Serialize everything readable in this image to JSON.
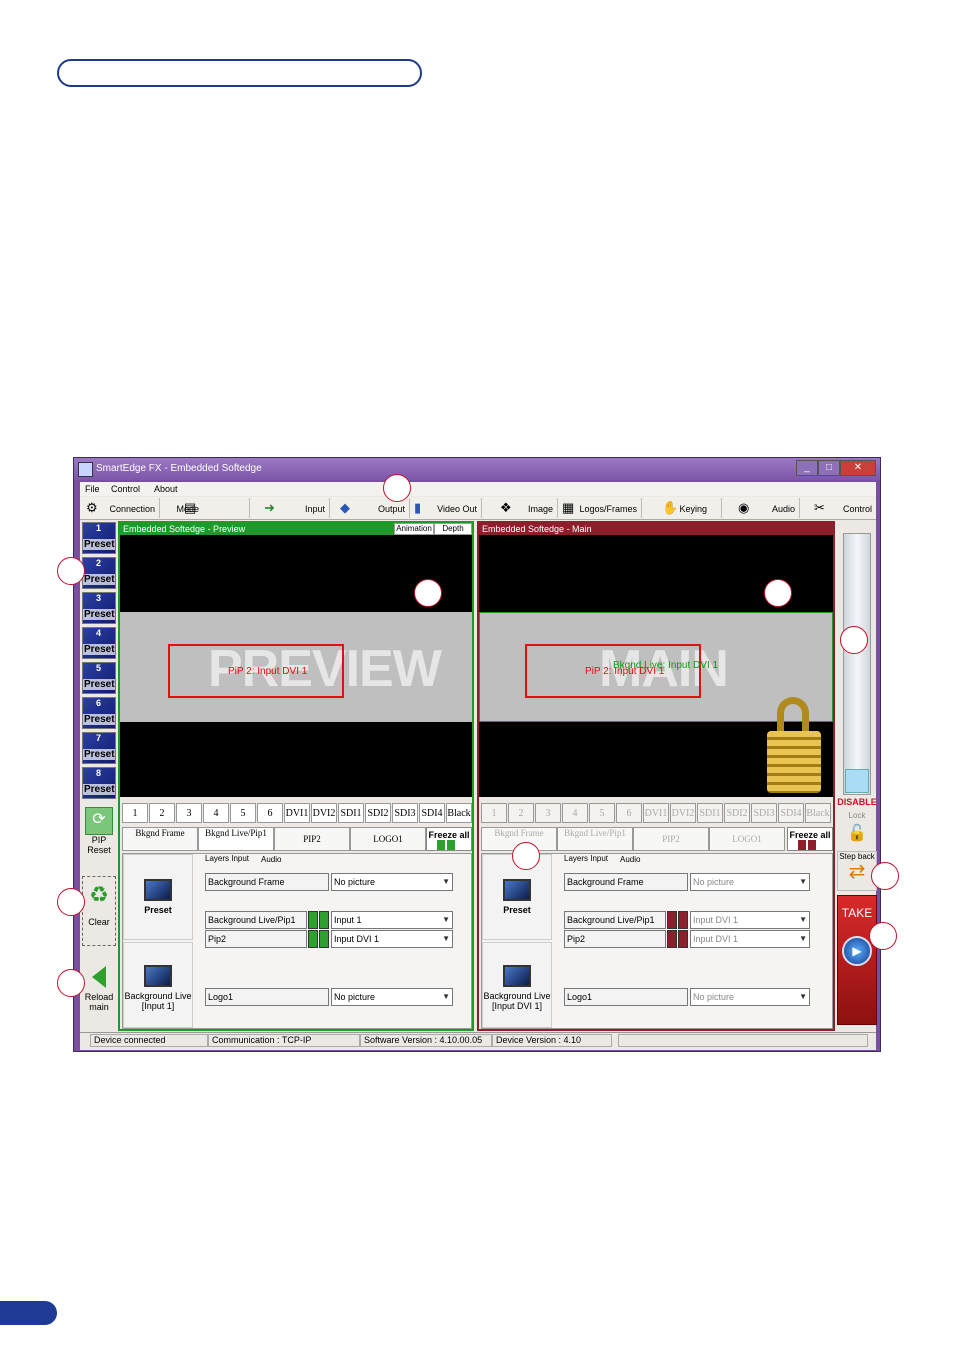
{
  "window": {
    "title": "SmartEdge FX - Embedded Softedge",
    "buttons": {
      "minimize": "_",
      "maximize": "□",
      "close": "✕"
    }
  },
  "menu": [
    "File",
    "Control",
    "About"
  ],
  "toolbar": [
    {
      "label": "Connection",
      "icon": "connection-icon"
    },
    {
      "label": "Mode",
      "icon": "mode-icon"
    },
    {
      "label": "Input",
      "icon": "input-icon"
    },
    {
      "label": "Output",
      "icon": "output-icon"
    },
    {
      "label": "Video Out",
      "icon": "video-out-icon"
    },
    {
      "label": "Image",
      "icon": "image-icon"
    },
    {
      "label": "Logos/Frames",
      "icon": "logos-icon"
    },
    {
      "label": "Keying",
      "icon": "keying-icon"
    },
    {
      "label": "Audio",
      "icon": "audio-icon"
    },
    {
      "label": "Control",
      "icon": "control-icon"
    }
  ],
  "presets": {
    "items": [
      {
        "num": "1",
        "label": "Preset"
      },
      {
        "num": "2",
        "label": "Preset"
      },
      {
        "num": "3",
        "label": "Preset"
      },
      {
        "num": "4",
        "label": "Preset"
      },
      {
        "num": "5",
        "label": "Preset"
      },
      {
        "num": "6",
        "label": "Preset"
      },
      {
        "num": "7",
        "label": "Preset"
      },
      {
        "num": "8",
        "label": "Preset"
      }
    ],
    "pip_reset": "PIP Reset",
    "clear": "Clear",
    "reload_main": "Reload main"
  },
  "preview": {
    "header": "Embedded Softedge - Preview",
    "tabs": [
      "Animation",
      "Depth"
    ],
    "watermark": "PREVIEW",
    "pip_label": "PiP 2: Input DVI 1",
    "sources": [
      "1",
      "2",
      "3",
      "4",
      "5",
      "6",
      "DVI1",
      "DVI2",
      "SDI1",
      "SDI2",
      "SDI3",
      "SDI4",
      "Black"
    ],
    "layer_tabs": [
      "Bkgnd Frame",
      "Bkgnd Live/Pip1",
      "PIP2",
      "LOGO1"
    ],
    "freeze": "Freeze all",
    "subtabs": [
      "Layers Input",
      "Audio"
    ],
    "preset_btn": "Preset",
    "bg_live_btn": "Background Live [Input 1]",
    "rows": [
      {
        "layer": "Background Frame",
        "value": "No picture"
      },
      {
        "layer": "Background Live/Pip1",
        "value": "Input 1"
      },
      {
        "layer": "Pip2",
        "value": "Input DVI 1"
      },
      {
        "layer": "Logo1",
        "value": "No picture"
      }
    ]
  },
  "main": {
    "header": "Embedded Softedge - Main",
    "watermark": "MAIN",
    "pip_label": "PiP 2: Input DVI 1",
    "bkgnd_label": "Bkgnd Live: Input DVI 1",
    "sources": [
      "1",
      "2",
      "3",
      "4",
      "5",
      "6",
      "DVI1",
      "DVI2",
      "SDI1",
      "SDI2",
      "SDI3",
      "SDI4",
      "Black"
    ],
    "layer_tabs": [
      "Bkgnd Frame",
      "Bkgnd Live/Pip1",
      "PIP2",
      "LOGO1"
    ],
    "freeze": "Freeze all",
    "subtabs": [
      "Layers Input",
      "Audio"
    ],
    "preset_btn": "Preset",
    "bg_live_btn": "Background Live [Input DVI 1]",
    "rows": [
      {
        "layer": "Background Frame",
        "value": "No picture"
      },
      {
        "layer": "Background Live/Pip1",
        "value": "Input DVI 1"
      },
      {
        "layer": "Pip2",
        "value": "Input DVI 1"
      },
      {
        "layer": "Logo1",
        "value": "No picture"
      }
    ]
  },
  "control": {
    "disable": "DISABLE",
    "lock": "Lock",
    "step_back": "Step back",
    "take": "TAKE"
  },
  "status": {
    "device": "Device connected",
    "communication": "Communication : TCP-IP",
    "software": "Software Version : 4.10.00.05",
    "device_version": "Device Version : 4.10"
  },
  "colors": {
    "preview_header": "#1f9a2a",
    "main_header": "#8b1f2b",
    "window_frame": "#7a4fa2",
    "callout": "#c0122e"
  }
}
